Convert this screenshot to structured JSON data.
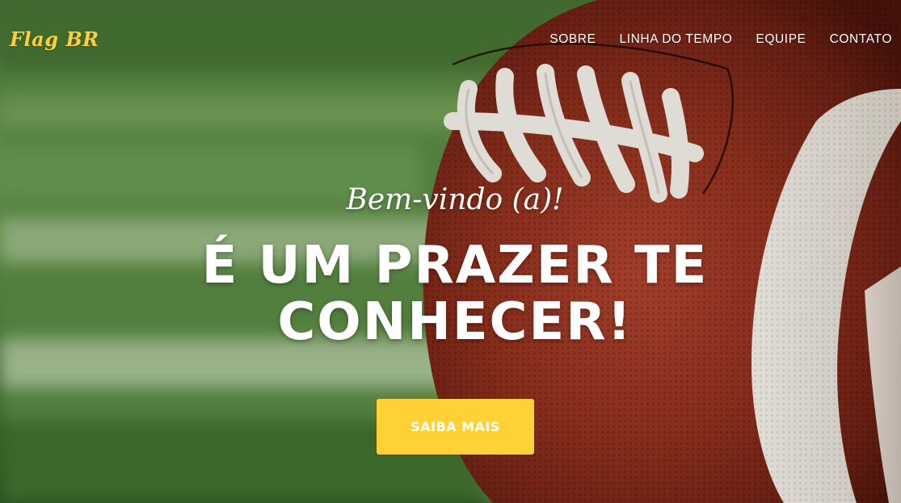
{
  "brand": {
    "name": "Flag BR",
    "color": "#fed136"
  },
  "nav": {
    "items": [
      {
        "label": "SOBRE"
      },
      {
        "label": "LINHA DO TEMPO"
      },
      {
        "label": "EQUIPE"
      },
      {
        "label": "CONTATO"
      }
    ]
  },
  "intro": {
    "lead_in": "Bem-vindo (a)!",
    "heading": "É UM PRAZER TE CONHECER!"
  },
  "cta": {
    "label": "SAIBA MAIS",
    "color": "#fed136"
  },
  "background": {
    "image": "american-football-on-grass-field"
  }
}
